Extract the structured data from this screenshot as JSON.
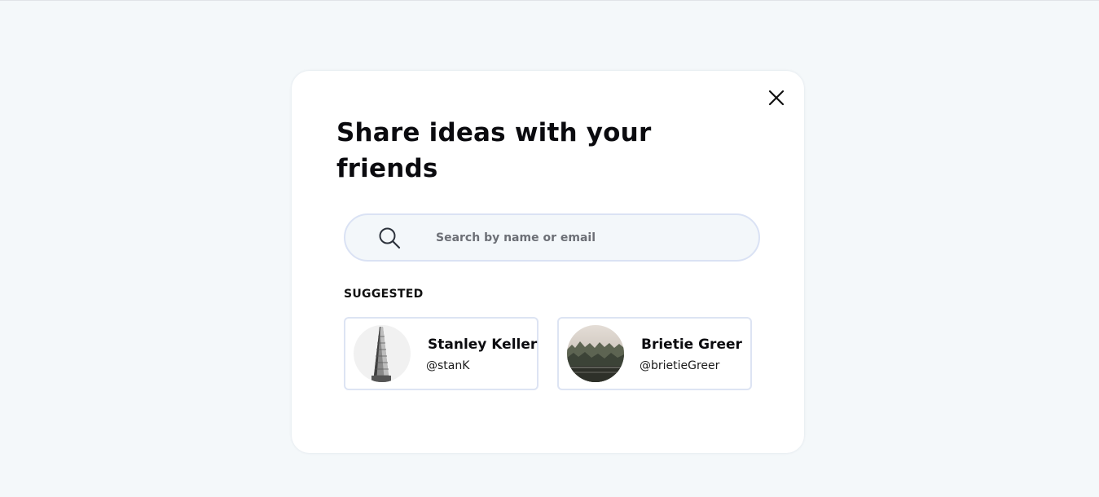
{
  "modal": {
    "title": "Share ideas with your friends",
    "close_icon": "close-icon"
  },
  "search": {
    "icon": "search-icon",
    "placeholder": "Search by name or email",
    "value": ""
  },
  "suggested": {
    "label": "SUGGESTED",
    "users": [
      {
        "name": "Stanley Keller",
        "handle": "@stanK",
        "avatar": "building-photo-avatar"
      },
      {
        "name": "Brietie Greer",
        "handle": "@brietieGreer",
        "avatar": "forest-photo-avatar"
      }
    ]
  },
  "colors": {
    "page_background": "#f4f8fa",
    "modal_background": "#ffffff",
    "search_border": "#dae2f4",
    "card_border": "#dde4f3",
    "text": "#0b0b0f"
  }
}
